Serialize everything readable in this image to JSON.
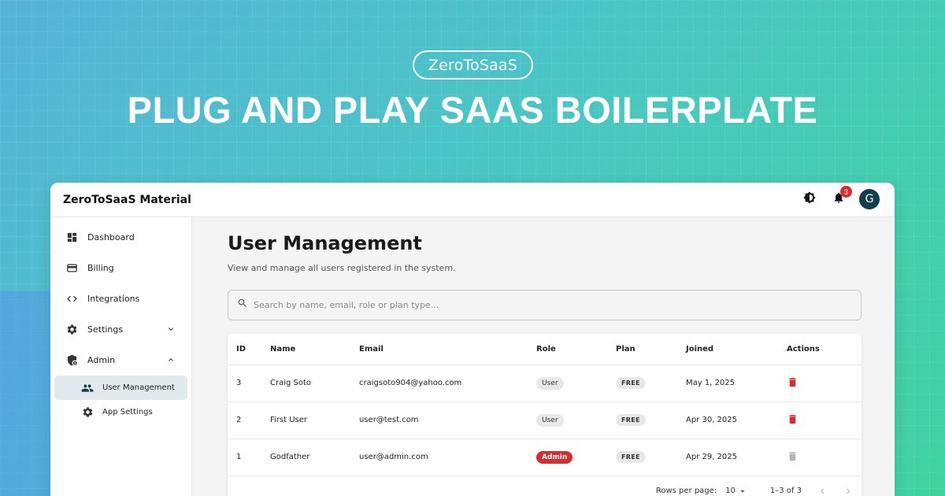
{
  "hero": {
    "pill": "ZeroToSaaS",
    "title": "PLUG AND PLAY SAAS BOILERPLATE"
  },
  "app": {
    "title": "ZeroToSaaS Material",
    "notifications_count": "3",
    "avatar_initial": "G"
  },
  "sidebar": {
    "items": [
      {
        "label": "Dashboard",
        "icon": "dashboard-icon"
      },
      {
        "label": "Billing",
        "icon": "credit-card-icon"
      },
      {
        "label": "Integrations",
        "icon": "code-icon"
      },
      {
        "label": "Settings",
        "icon": "gear-icon",
        "expandable": true,
        "expanded": false
      },
      {
        "label": "Admin",
        "icon": "admin-shield-icon",
        "expandable": true,
        "expanded": true
      }
    ],
    "sub_items": [
      {
        "label": "User Management",
        "icon": "people-icon",
        "active": true
      },
      {
        "label": "App Settings",
        "icon": "gear-icon",
        "active": false
      }
    ]
  },
  "main": {
    "title": "User Management",
    "subtitle": "View and manage all users registered in the system.",
    "search_placeholder": "Search by name, email, role or plan type..."
  },
  "table": {
    "columns": [
      "ID",
      "Name",
      "Email",
      "Role",
      "Plan",
      "Joined",
      "Actions"
    ],
    "rows": [
      {
        "id": "3",
        "name": "Craig Soto",
        "email": "craigsoto904@yahoo.com",
        "role": "User",
        "plan": "FREE",
        "joined": "May 1, 2025",
        "delete_enabled": true
      },
      {
        "id": "2",
        "name": "First User",
        "email": "user@test.com",
        "role": "User",
        "plan": "FREE",
        "joined": "Apr 30, 2025",
        "delete_enabled": true
      },
      {
        "id": "1",
        "name": "Godfather",
        "email": "user@admin.com",
        "role": "Admin",
        "plan": "FREE",
        "joined": "Apr 29, 2025",
        "delete_enabled": false
      }
    ]
  },
  "pagination": {
    "rows_per_page_label": "Rows per page:",
    "rows_per_page_value": "10",
    "range": "1–3 of 3"
  },
  "colors": {
    "danger": "#d32f2f",
    "avatar_bg": "#0e3f4a",
    "active_nav_bg": "#e3eaed"
  }
}
